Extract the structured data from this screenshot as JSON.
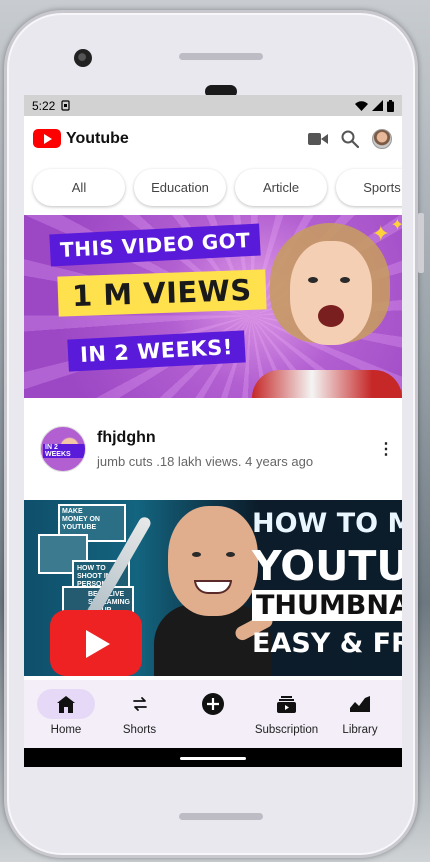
{
  "status_bar": {
    "time": "5:22"
  },
  "app_bar": {
    "title": "Youtube"
  },
  "chips": [
    "All",
    "Education",
    "Article",
    "Sports"
  ],
  "videos": [
    {
      "thumbnail_text": [
        "THIS VIDEO GOT",
        "1 M VIEWS",
        "IN 2 WEEKS!"
      ],
      "title": "fhjdghn",
      "subtitle": "jumb cuts .18 lakh views. 4 years ago",
      "avatar_text": "IN 2 WEEKS"
    },
    {
      "thumbnail_text": [
        "HOW TO MAK",
        "YOUTUBE",
        "THUMBNAIL",
        "EASY & FRE"
      ],
      "collage_text": [
        "MAKE MONEY ON YOUTUBE",
        "HOW TO SHOOT IN PERSON",
        "BEST LIVE STREAMING SETUP"
      ]
    }
  ],
  "bottom_nav": [
    {
      "label": "Home",
      "icon": "home-icon",
      "active": true
    },
    {
      "label": "Shorts",
      "icon": "repeat-icon",
      "active": false
    },
    {
      "label": "",
      "icon": "add-circle-icon",
      "active": false
    },
    {
      "label": "Subscription",
      "icon": "subscriptions-icon",
      "active": false
    },
    {
      "label": "Library",
      "icon": "library-icon",
      "active": false
    }
  ],
  "colors": {
    "brand_red": "#ff0000",
    "nav_background": "#f3eef8",
    "nav_active_pill": "#e6d9f7"
  }
}
